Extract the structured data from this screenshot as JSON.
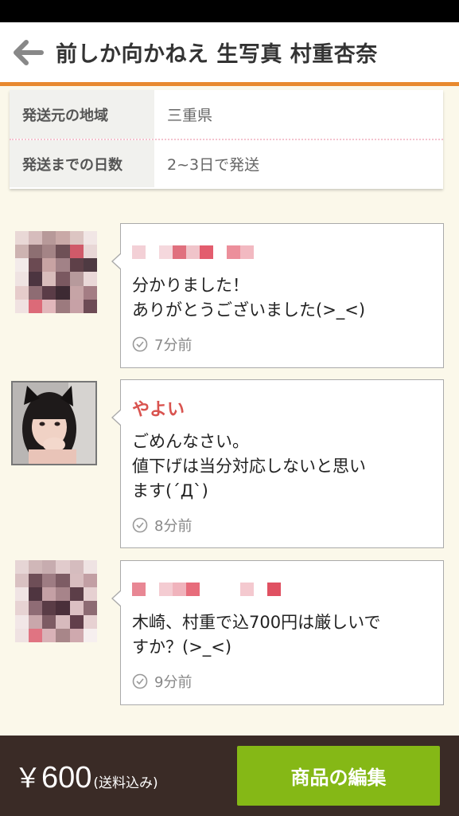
{
  "header": {
    "title": "前しか向かねえ 生写真 村重杏奈",
    "back_icon": "arrow-left-icon"
  },
  "info": [
    {
      "label": "発送元の地域",
      "value": "三重県"
    },
    {
      "label": "発送までの日数",
      "value": "2~3日で発送"
    }
  ],
  "comments": [
    {
      "name": "",
      "name_redacted": true,
      "text": "分かりました！\nありがとうございました(>_<)",
      "time": "7分前",
      "avatar": "pixelated-avatar"
    },
    {
      "name": "やよい",
      "name_redacted": false,
      "text": "ごめんなさい。\n値下げは当分対応しないと思い\nます(´Д`)",
      "time": "8分前",
      "avatar": "user-photo-avatar"
    },
    {
      "name": "",
      "name_redacted": true,
      "text": "木崎、村重で込700円は厳しいで\nすか？(>_<)",
      "time": "9分前",
      "avatar": "pixelated-avatar"
    }
  ],
  "footer": {
    "currency": "￥",
    "price": "600",
    "price_note": "(送料込み)",
    "edit_button": "商品の編集"
  },
  "colors": {
    "accent": "#e8892e",
    "button": "#85b816",
    "footer_bg": "#3a2b26",
    "name": "#d9534f",
    "background": "#fbf8ea"
  }
}
